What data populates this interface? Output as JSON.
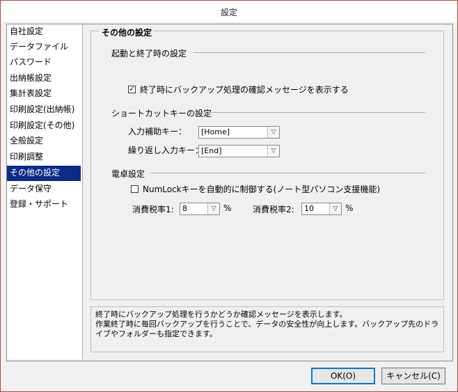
{
  "window": {
    "title": "設定"
  },
  "sidebar": {
    "items": [
      {
        "label": "自社設定"
      },
      {
        "label": "データファイル"
      },
      {
        "label": "パスワード"
      },
      {
        "label": "出納帳設定"
      },
      {
        "label": "集計表設定"
      },
      {
        "label": "印刷設定(出納帳)"
      },
      {
        "label": "印刷設定(その他)"
      },
      {
        "label": "全般設定"
      },
      {
        "label": "印刷調整"
      },
      {
        "label": "その他の設定",
        "selected": true
      },
      {
        "label": "データ保守"
      },
      {
        "label": "登録・サポート"
      }
    ]
  },
  "panel": {
    "title": "その他の設定",
    "startup": {
      "title": "起動と終了時の設定",
      "backup_confirm": {
        "label": "終了時にバックアップ処理の確認メッセージを表示する",
        "checked": true,
        "mark": "✓"
      }
    },
    "shortcut": {
      "title": "ショートカットキーの設定",
      "input_assist": {
        "label": "入力補助キー：",
        "value": "[Home]"
      },
      "repeat_input": {
        "label": "繰り返し入力キー：",
        "value": "[End]"
      }
    },
    "calculator": {
      "title": "電卓設定",
      "numlock": {
        "label": "NumLockキーを自動的に制御する(ノート型パソコン支援機能)",
        "checked": false
      },
      "tax1": {
        "label": "消費税率1:",
        "value": "8",
        "unit": "%"
      },
      "tax2": {
        "label": "消費税率2:",
        "value": "10",
        "unit": "%"
      }
    }
  },
  "help": {
    "line1": "終了時にバックアップ処理を行うかどうか確認メッセージを表示します。",
    "line2": "作業終了時に毎回バックアップを行うことで、データの安全性が向上します。バックアップ先のドライブやフォルダーも指定できます。"
  },
  "buttons": {
    "ok": "OK(O)",
    "cancel": "キャンセル(C)"
  },
  "icons": {
    "dropdown": "chevron-down-icon",
    "dropdown_glyph": "▽"
  }
}
